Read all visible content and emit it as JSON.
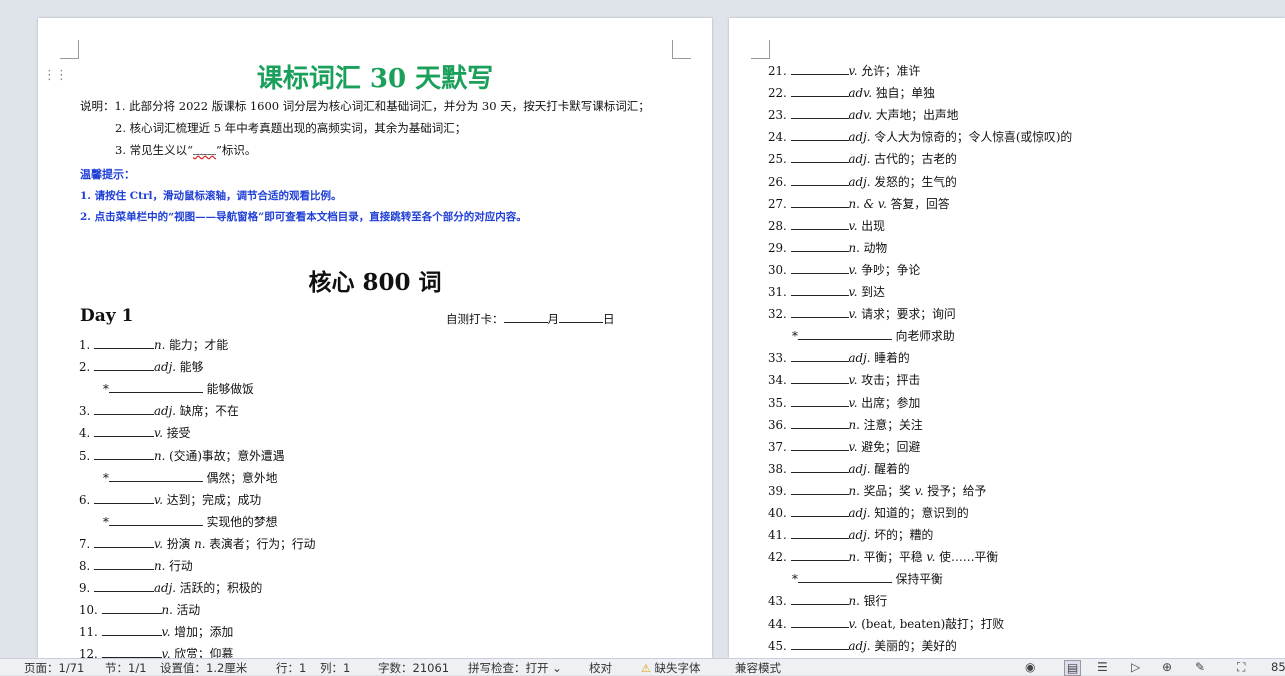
{
  "doc": {
    "title": "课标词汇 30 天默写",
    "notes": [
      "说明：1. 此部分将 2022 版课标 1600 词分层为核心词汇和基础词汇，并分为 30 天，按天打卡默写课标词汇；",
      "2. 核心词汇梳理近 5 年中考真题出现的高频实词，其余为基础词汇；",
      "3. 常见生义以“",
      "”标识。"
    ],
    "wave_mark": "﹏﹏",
    "tips_label": "温馨提示：",
    "tips": [
      "1. 请按住 Ctrl，滑动鼠标滚轴，调节合适的观看比例。",
      "2. 点击菜单栏中的“视图——导航窗格”即可查看本文档目录，直接跳转至各个部分的对应内容。"
    ],
    "section_title": "核心 800 词",
    "day_label": "Day 1",
    "checkin": {
      "prefix": "自测打卡：",
      "month": "月",
      "day": "日"
    }
  },
  "left_rows": [
    {
      "n": "1.",
      "pos": "n.",
      "def": "能力；才能"
    },
    {
      "n": "2.",
      "pos": "adj.",
      "def": "能够"
    },
    {
      "sub": "*",
      "def": "能够做饭"
    },
    {
      "n": "3.",
      "pos": "adj.",
      "def": "缺席；不在"
    },
    {
      "n": "4.",
      "pos": "v.",
      "def": "接受"
    },
    {
      "n": "5.",
      "pos": "n.",
      "def": "(交通)事故；意外遭遇"
    },
    {
      "sub": "*",
      "def": "偶然；意外地"
    },
    {
      "n": "6.",
      "pos": "v.",
      "def": "达到；完成；成功"
    },
    {
      "sub": "*",
      "def": "实现他的梦想"
    },
    {
      "n": "7.",
      "pos": "v.",
      "def": "扮演",
      "pos2": "n.",
      "def2": "表演者；行为；行动"
    },
    {
      "n": "8.",
      "pos": "n.",
      "def": "行动"
    },
    {
      "n": "9.",
      "pos": "adj.",
      "def": "活跃的；积极的"
    },
    {
      "n": "10.",
      "pos": "n.",
      "def": "活动"
    },
    {
      "n": "11.",
      "pos": "v.",
      "def": "增加；添加"
    },
    {
      "n": "12.",
      "pos": "v.",
      "def": "欣赏；仰慕"
    }
  ],
  "right_rows": [
    {
      "n": "21.",
      "pos": "v.",
      "def": "允许；准许"
    },
    {
      "n": "22.",
      "pos": "adv.",
      "def": "独自；单独"
    },
    {
      "n": "23.",
      "pos": "adv.",
      "def": "大声地；出声地"
    },
    {
      "n": "24.",
      "pos": "adj.",
      "def": "令人大为惊奇的；令人惊喜(或惊叹)的"
    },
    {
      "n": "25.",
      "pos": "adj.",
      "def": "古代的；古老的"
    },
    {
      "n": "26.",
      "pos": "adj.",
      "def": "发怒的；生气的"
    },
    {
      "n": "27.",
      "pos": "n. & v.",
      "def": "答复，回答"
    },
    {
      "n": "28.",
      "pos": "v.",
      "def": "出现"
    },
    {
      "n": "29.",
      "pos": "n.",
      "def": "动物"
    },
    {
      "n": "30.",
      "pos": "v.",
      "def": "争吵；争论"
    },
    {
      "n": "31.",
      "pos": "v.",
      "def": "到达"
    },
    {
      "n": "32.",
      "pos": "v.",
      "def": "请求；要求；询问"
    },
    {
      "sub": "*",
      "def": "向老师求助"
    },
    {
      "n": "33.",
      "pos": "adj.",
      "def": "睡着的"
    },
    {
      "n": "34.",
      "pos": "v.",
      "def": "攻击；抨击"
    },
    {
      "n": "35.",
      "pos": "v.",
      "def": "出席；参加"
    },
    {
      "n": "36.",
      "pos": "n.",
      "def": "注意；关注"
    },
    {
      "n": "37.",
      "pos": "v.",
      "def": "避免；回避"
    },
    {
      "n": "38.",
      "pos": "adj.",
      "def": "醒着的"
    },
    {
      "n": "39.",
      "pos": "n.",
      "def": "奖品；奖",
      "pos2": "v.",
      "def2": "授予；给予"
    },
    {
      "n": "40.",
      "pos": "adj.",
      "def": "知道的；意识到的"
    },
    {
      "n": "41.",
      "pos": "adj.",
      "def": "坏的；糟的"
    },
    {
      "n": "42.",
      "pos": "n.",
      "def": "平衡；平稳",
      "pos2": "v.",
      "def2": "使……平衡"
    },
    {
      "sub": "*",
      "def": "保持平衡"
    },
    {
      "n": "43.",
      "pos": "n.",
      "def": "银行"
    },
    {
      "n": "44.",
      "pos": "v.",
      "def": "(beat, beaten)敲打；打败"
    },
    {
      "n": "45.",
      "pos": "adj.",
      "def": "美丽的；美好的"
    }
  ],
  "status": {
    "page": "页面：1/71",
    "section": "节：1/1",
    "setting": "设置值：1.2厘米",
    "row": "行：1",
    "col": "列：1",
    "wordcount": "字数：21061",
    "spell": "拼写检查：打开 ⌄",
    "proof": "校对",
    "missing_font": "缺失字体",
    "compat": "兼容模式",
    "zoom": "85"
  }
}
